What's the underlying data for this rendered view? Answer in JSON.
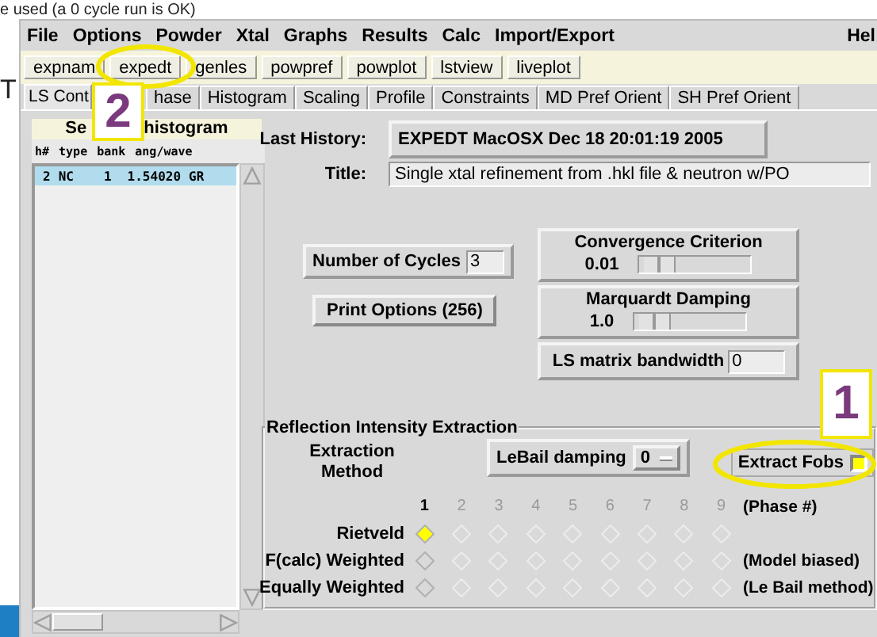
{
  "caption": "e used (a 0 cycle run is OK)",
  "side_text": "T",
  "menu": [
    "File",
    "Options",
    "Powder",
    "Xtal",
    "Graphs",
    "Results",
    "Calc",
    "Import/Export"
  ],
  "help": "Hel",
  "toolbar": [
    "expnam",
    "expedt",
    "genles",
    "powpref",
    "powplot",
    "lstview",
    "liveplot"
  ],
  "tabs": [
    {
      "label": "LS Cont",
      "selected": true
    },
    {
      "label": "hase",
      "selected": false
    },
    {
      "label": "Histogram",
      "selected": false
    },
    {
      "label": "Scaling",
      "selected": false
    },
    {
      "label": "Profile",
      "selected": false
    },
    {
      "label": "Constraints",
      "selected": false
    },
    {
      "label": "MD Pref Orient",
      "selected": false
    },
    {
      "label": "SH Pref Orient",
      "selected": false
    }
  ],
  "histogram_panel": {
    "title_parts": [
      "Se",
      "histogram"
    ],
    "columns": [
      "h#",
      "type",
      "bank",
      "ang/wave"
    ],
    "rows": [
      {
        "cells": [
          "2",
          "NC",
          "1",
          "1.54020",
          "GR"
        ],
        "selected": true
      }
    ]
  },
  "last_history": {
    "label": "Last History:",
    "value": "EXPEDT  MacOSX Dec 18 20:01:19 2005"
  },
  "title": {
    "label": "Title:",
    "value": "Single xtal refinement from .hkl file & neutron w/PO"
  },
  "cycles": {
    "label": "Number of Cycles",
    "value": "3"
  },
  "print_options": "Print Options (256)",
  "sliders": [
    {
      "label": "Convergence Criterion",
      "reading": "0.01",
      "level": 0.05
    },
    {
      "label": "Marquardt Damping",
      "reading": "1.0",
      "level": 0.05
    }
  ],
  "bandwidth": {
    "label": "LS matrix bandwidth",
    "value": "0"
  },
  "extraction": {
    "title": "Reflection Intensity Extraction",
    "method_label": "Extraction Method",
    "lebail": {
      "label": "LeBail damping",
      "value": "0"
    },
    "extract_fobs": {
      "label": "Extract Fobs",
      "checked": true
    },
    "phases": [
      {
        "label": "1",
        "disabled": false
      },
      {
        "label": "2",
        "disabled": true
      },
      {
        "label": "3",
        "disabled": true
      },
      {
        "label": "4",
        "disabled": true
      },
      {
        "label": "5",
        "disabled": true
      },
      {
        "label": "6",
        "disabled": true
      },
      {
        "label": "7",
        "disabled": true
      },
      {
        "label": "8",
        "disabled": true
      },
      {
        "label": "9",
        "disabled": true
      }
    ],
    "phase_caption": "(Phase #)",
    "methods": [
      {
        "label": "Rietveld",
        "options": [
          {
            "selected": true
          },
          {
            "selected": false
          },
          {
            "selected": false
          },
          {
            "selected": false
          },
          {
            "selected": false
          },
          {
            "selected": false
          },
          {
            "selected": false
          },
          {
            "selected": false
          },
          {
            "selected": false
          }
        ]
      },
      {
        "label": "F(calc) Weighted",
        "note": "(Model biased)",
        "options": [
          {
            "selected": false
          },
          {
            "selected": false
          },
          {
            "selected": false
          },
          {
            "selected": false
          },
          {
            "selected": false
          },
          {
            "selected": false
          },
          {
            "selected": false
          },
          {
            "selected": false
          },
          {
            "selected": false
          }
        ]
      },
      {
        "label": "Equally Weighted",
        "note": "(Le Bail method)",
        "options": [
          {
            "selected": false
          },
          {
            "selected": false
          },
          {
            "selected": false
          },
          {
            "selected": false
          },
          {
            "selected": false
          },
          {
            "selected": false
          },
          {
            "selected": false
          },
          {
            "selected": false
          },
          {
            "selected": false
          }
        ]
      }
    ]
  },
  "callouts": [
    {
      "number": "2"
    },
    {
      "number": "1"
    }
  ]
}
